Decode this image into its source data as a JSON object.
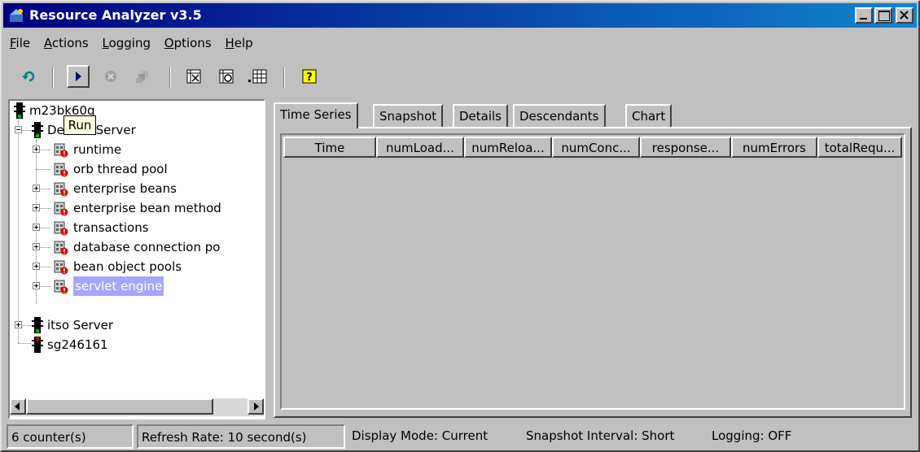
{
  "window": {
    "title": "Resource Analyzer v3.5",
    "controls": [
      "minimize",
      "maximize",
      "close"
    ]
  },
  "menubar": [
    {
      "mnemonic": "F",
      "rest": "ile"
    },
    {
      "mnemonic": "A",
      "rest": "ctions"
    },
    {
      "mnemonic": "L",
      "rest": "ogging"
    },
    {
      "mnemonic": "O",
      "rest": "ptions"
    },
    {
      "mnemonic": "H",
      "rest": "elp"
    }
  ],
  "toolbar": {
    "icons": [
      "refresh-icon",
      "run-icon",
      "stop-icon",
      "clear-icon",
      "table-close-icon",
      "table-config-icon",
      "table-add-icon",
      "help-icon"
    ],
    "tooltip": "Run"
  },
  "tree": {
    "root": "m23bk60g",
    "server1": "Default Server",
    "children": [
      "runtime",
      "orb thread pool",
      "enterprise beans",
      "enterprise bean method",
      "transactions",
      "database connection po",
      "bean object pools",
      "servlet engine"
    ],
    "server2": "itso Server",
    "server3": "sg246161"
  },
  "tabs": [
    "Time Series",
    "Snapshot",
    "Details",
    "Descendants",
    "Chart"
  ],
  "table": {
    "columns": [
      "Time",
      "numLoad...",
      "numReloa...",
      "numConc...",
      "response...",
      "numErrors",
      "totalRequ..."
    ]
  },
  "status": {
    "counters": "6 counter(s)",
    "refresh": "Refresh Rate: 10 second(s)",
    "display": "Display Mode: Current",
    "snapshot": "Snapshot Interval: Short",
    "logging": "Logging: OFF"
  },
  "colors": {
    "title_gradient_start": "#000080",
    "title_gradient_end": "#1084d0",
    "selection": "#a6a6ff",
    "tooltip_bg": "#ffffe1",
    "face": "#c0c0c0"
  }
}
